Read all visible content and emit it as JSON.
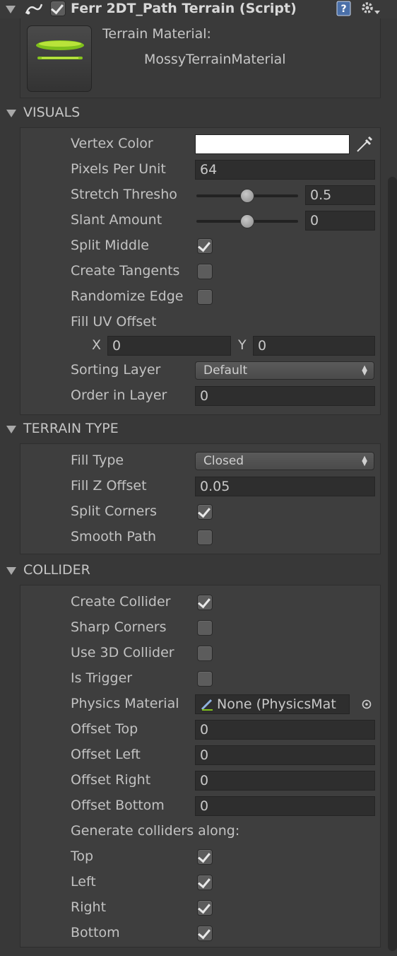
{
  "component": {
    "title": "Ferr 2DT_Path Terrain (Script)",
    "enabled": true,
    "material_label": "Terrain Material:",
    "material_name": "MossyTerrainMaterial"
  },
  "visuals": {
    "header": "VISUALS",
    "vertex_color_label": "Vertex Color",
    "vertex_color_value": "#ffffff",
    "pixels_per_unit_label": "Pixels Per Unit",
    "pixels_per_unit_value": "64",
    "stretch_threshold_label": "Stretch Thresho",
    "stretch_threshold_value": "0.5",
    "stretch_threshold_fraction": 0.5,
    "slant_amount_label": "Slant Amount",
    "slant_amount_value": "0",
    "slant_amount_fraction": 0.5,
    "split_middle_label": "Split Middle",
    "split_middle_checked": true,
    "create_tangents_label": "Create Tangents",
    "create_tangents_checked": false,
    "randomize_edge_label": "Randomize Edge",
    "randomize_edge_checked": false,
    "fill_uv_offset_label": "Fill UV Offset",
    "x_label": "X",
    "x_value": "0",
    "y_label": "Y",
    "y_value": "0",
    "sorting_layer_label": "Sorting Layer",
    "sorting_layer_value": "Default",
    "order_in_layer_label": "Order in Layer",
    "order_in_layer_value": "0"
  },
  "terrain_type": {
    "header": "TERRAIN TYPE",
    "fill_type_label": "Fill Type",
    "fill_type_value": "Closed",
    "fill_z_offset_label": "Fill Z Offset",
    "fill_z_offset_value": "0.05",
    "split_corners_label": "Split Corners",
    "split_corners_checked": true,
    "smooth_path_label": "Smooth Path",
    "smooth_path_checked": false
  },
  "collider": {
    "header": "COLLIDER",
    "create_collider_label": "Create Collider",
    "create_collider_checked": true,
    "sharp_corners_label": "Sharp Corners",
    "sharp_corners_checked": false,
    "use_3d_collider_label": "Use 3D Collider",
    "use_3d_collider_checked": false,
    "is_trigger_label": "Is Trigger",
    "is_trigger_checked": false,
    "physics_material_label": "Physics Material",
    "physics_material_value": "None (PhysicsMat",
    "offset_top_label": "Offset Top",
    "offset_top_value": "0",
    "offset_left_label": "Offset Left",
    "offset_left_value": "0",
    "offset_right_label": "Offset Right",
    "offset_right_value": "0",
    "offset_bottom_label": "Offset Bottom",
    "offset_bottom_value": "0",
    "generate_along_label": "Generate colliders along:",
    "top_label": "Top",
    "top_checked": true,
    "left_label": "Left",
    "left_checked": true,
    "right_label": "Right",
    "right_checked": true,
    "bottom_label": "Bottom",
    "bottom_checked": true
  },
  "icons": [
    "fold-arrow-icon",
    "script-icon",
    "help-icon",
    "gear-icon",
    "eyedropper-icon",
    "object-picker-icon",
    "dropdown-arrows-icon"
  ]
}
